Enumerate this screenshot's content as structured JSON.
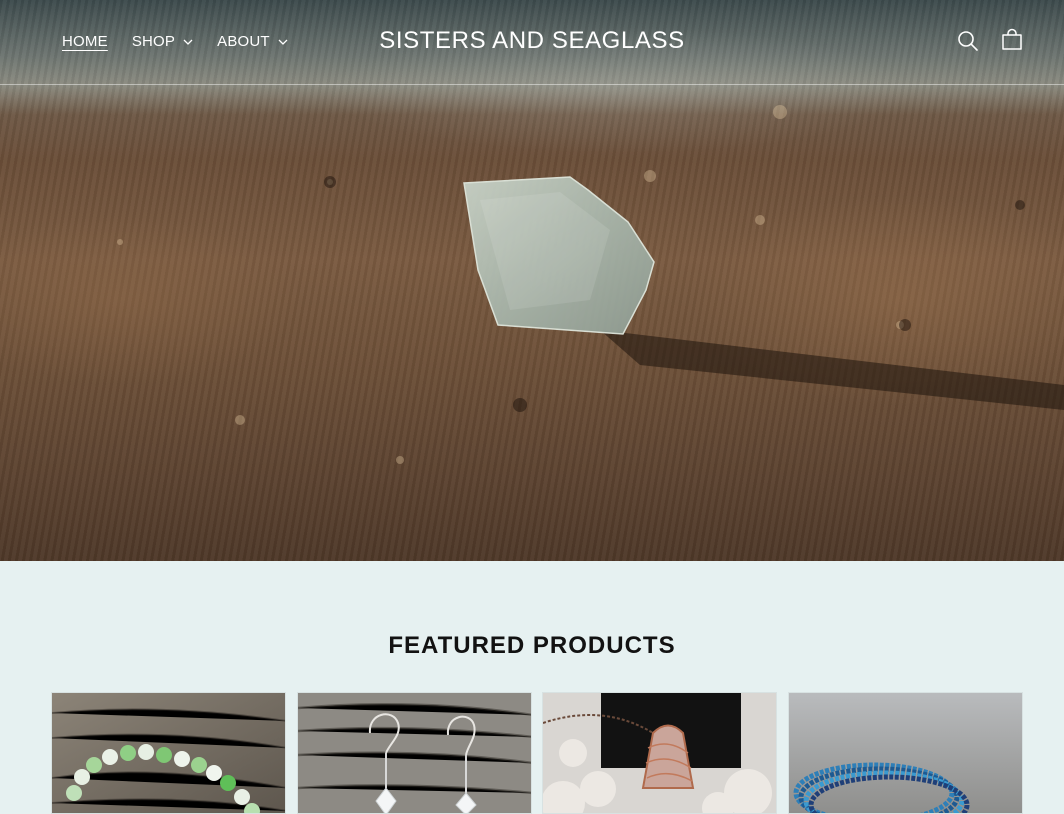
{
  "header": {
    "nav": [
      {
        "label": "HOME",
        "active": true,
        "has_dropdown": false
      },
      {
        "label": "SHOP",
        "active": false,
        "has_dropdown": true
      },
      {
        "label": "ABOUT",
        "active": false,
        "has_dropdown": true
      }
    ],
    "brand": "SISTERS AND SEAGLASS",
    "icons": [
      "search-icon",
      "cart-icon"
    ]
  },
  "hero": {
    "image": "sea-glass-on-sand"
  },
  "featured": {
    "title": "FEATURED PRODUCTS",
    "products": [
      {
        "image": "green-sea-glass-bracelet"
      },
      {
        "image": "crystal-drop-earrings"
      },
      {
        "image": "copper-wire-wrapped-pendant"
      },
      {
        "image": "blue-beaded-bracelets"
      }
    ]
  },
  "colors": {
    "section_bg": "#e6f1f1",
    "header_text": "#ffffff",
    "title_text": "#121212"
  }
}
